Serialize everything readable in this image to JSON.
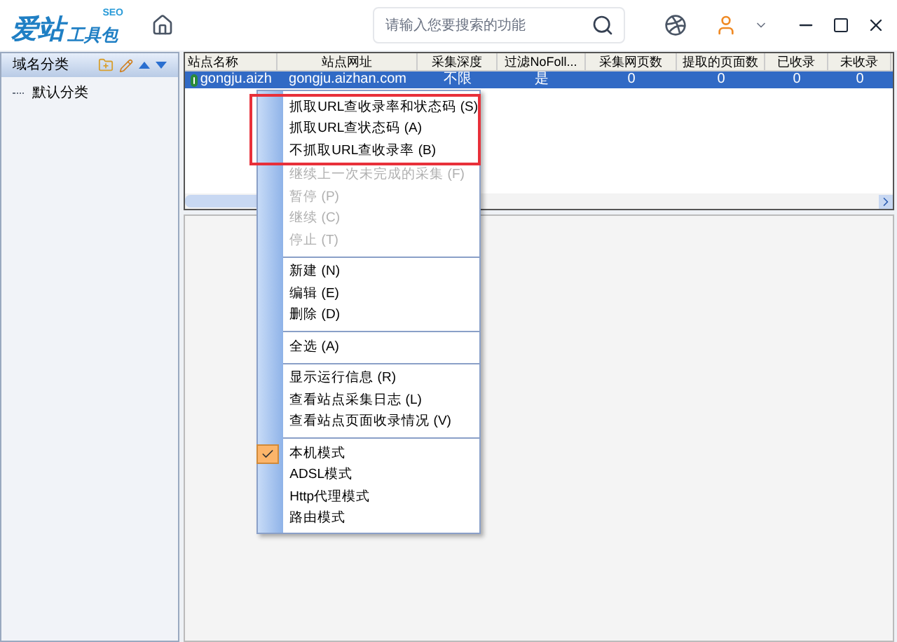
{
  "header": {
    "logo_main": "爱站",
    "logo_tools": "工具包",
    "logo_badge": "SEO",
    "search": {
      "placeholder": "请输入您要搜索的功能"
    }
  },
  "sidebar": {
    "title": "域名分类",
    "items": [
      {
        "label": "默认分类",
        "selected": false
      }
    ]
  },
  "table": {
    "columns": [
      "站点名称",
      "站点网址",
      "采集深度",
      "过滤NoFoll...",
      "采集网页数",
      "提取的页面数",
      "已收录",
      "未收录"
    ],
    "rows": [
      {
        "selected": true,
        "cells": [
          "gongju.aizh",
          "gongju.aizhan.com",
          "不限",
          "是",
          "0",
          "0",
          "0",
          "0"
        ]
      }
    ]
  },
  "context_menu": {
    "highlighted_items": [
      {
        "label": "抓取URL查收录率和状态码",
        "key": "(S)",
        "disabled": false
      },
      {
        "label": "抓取URL查状态码",
        "key": "(A)",
        "disabled": false
      },
      {
        "label": "不抓取URL查收录率",
        "key": "(B)",
        "disabled": false
      }
    ],
    "items": [
      {
        "kind": "item",
        "label": "继续上一次未完成的采集",
        "key": "(F)",
        "disabled": true,
        "checked": false
      },
      {
        "kind": "item",
        "label": "暂停",
        "key": "(P)",
        "disabled": true,
        "checked": false
      },
      {
        "kind": "item",
        "label": "继续",
        "key": "(C)",
        "disabled": true,
        "checked": false
      },
      {
        "kind": "item",
        "label": "停止",
        "key": "(T)",
        "disabled": true,
        "checked": false
      },
      {
        "kind": "separator"
      },
      {
        "kind": "item",
        "label": "新建",
        "key": "(N)",
        "disabled": false,
        "checked": false
      },
      {
        "kind": "item",
        "label": "编辑",
        "key": "(E)",
        "disabled": false,
        "checked": false
      },
      {
        "kind": "item",
        "label": "删除",
        "key": "(D)",
        "disabled": false,
        "checked": false
      },
      {
        "kind": "separator"
      },
      {
        "kind": "item",
        "label": "全选",
        "key": "(A)",
        "disabled": false,
        "checked": false
      },
      {
        "kind": "separator"
      },
      {
        "kind": "item",
        "label": "显示运行信息",
        "key": "(R)",
        "disabled": false,
        "checked": false
      },
      {
        "kind": "item",
        "label": "查看站点采集日志",
        "key": "(L)",
        "disabled": false,
        "checked": false
      },
      {
        "kind": "item",
        "label": "查看站点页面收录情况",
        "key": "(V)",
        "disabled": false,
        "checked": false
      },
      {
        "kind": "separator"
      },
      {
        "kind": "item",
        "label": "本机模式",
        "disabled": false,
        "checked": true
      },
      {
        "kind": "item",
        "label": "ADSL模式",
        "disabled": false,
        "checked": false
      },
      {
        "kind": "item",
        "label": "Http代理模式",
        "disabled": false,
        "checked": false
      },
      {
        "kind": "item",
        "label": "路由模式",
        "disabled": false,
        "checked": false
      }
    ]
  }
}
